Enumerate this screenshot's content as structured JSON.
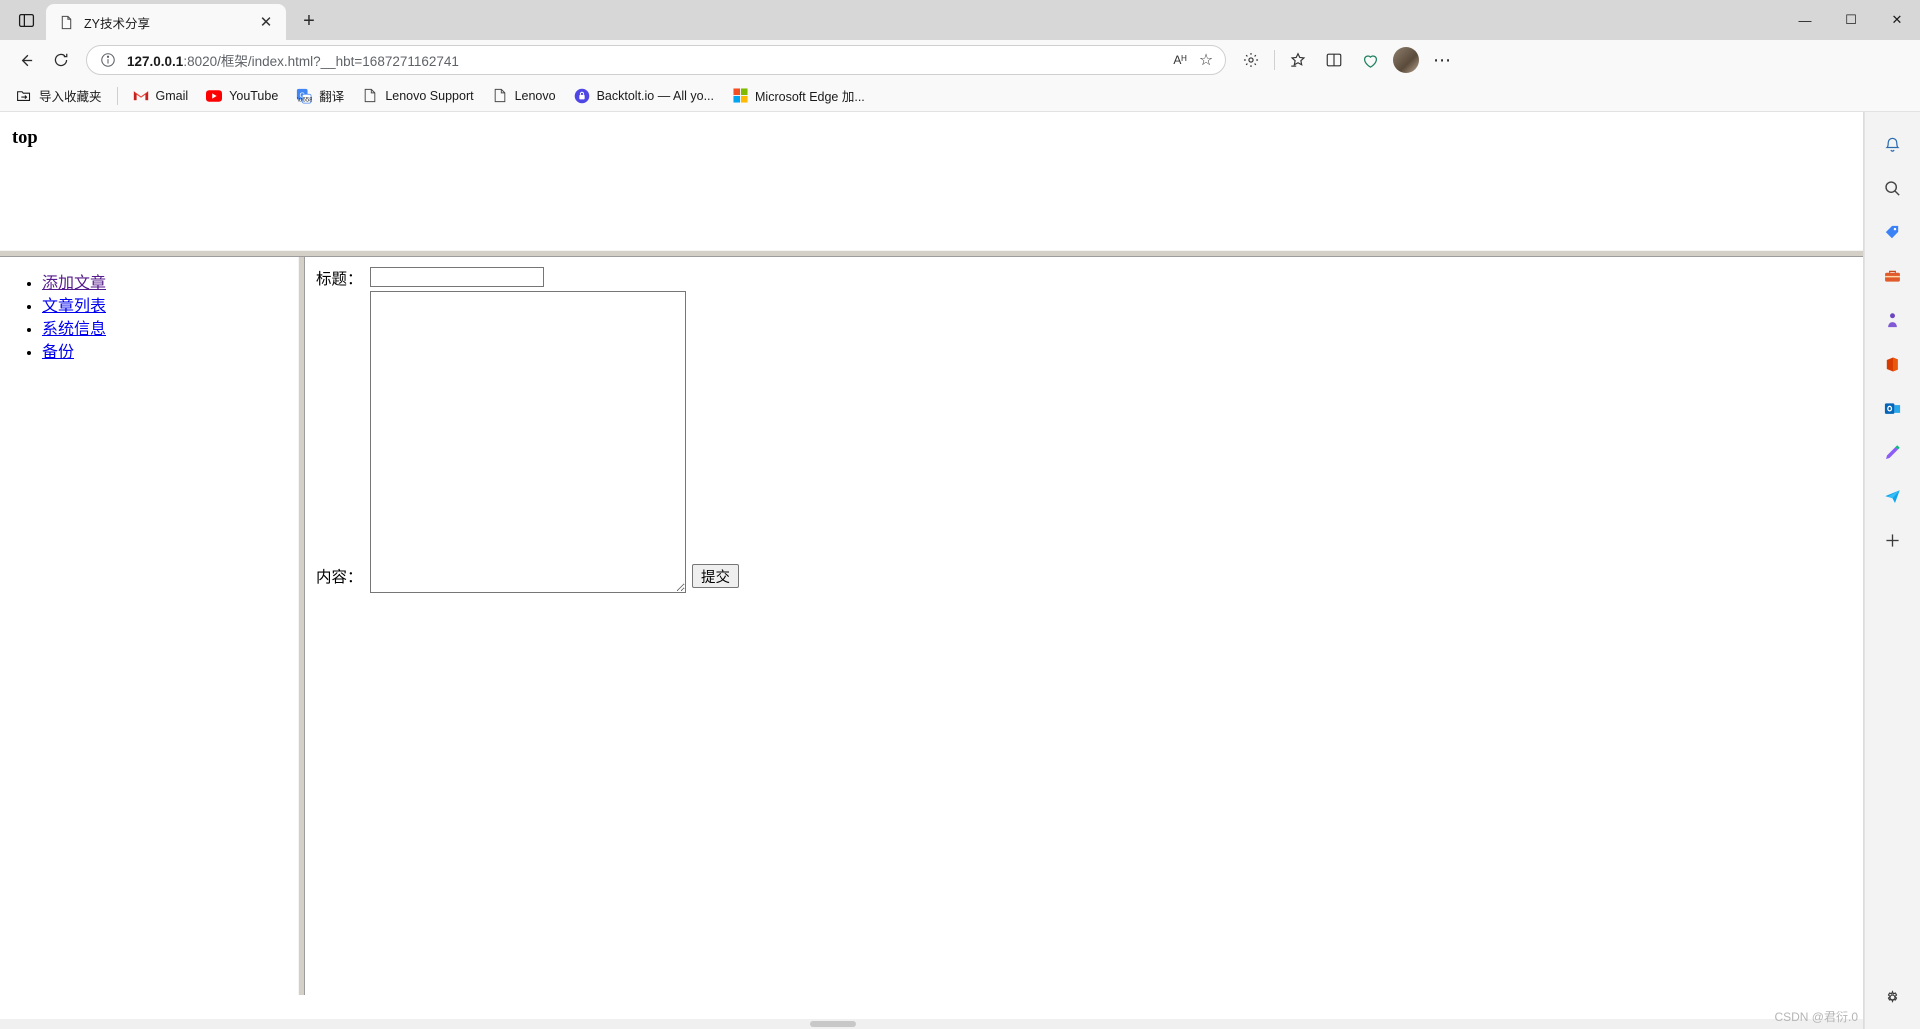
{
  "window": {
    "controls": {
      "minimize": "—",
      "maximize": "☐",
      "close": "✕"
    }
  },
  "tabstrip": {
    "sidebar_toggle": "tab-actions-icon",
    "new_tab_label": "+",
    "tabs": [
      {
        "title": "ZY技术分享",
        "favicon": "document-icon",
        "close": "✕"
      }
    ]
  },
  "navbar": {
    "back": "←",
    "refresh": "⟳",
    "url_host": "127.0.0.1",
    "url_rest": ":8020/框架/index.html?__hbt=1687271162741",
    "full_url": "127.0.0.1:8020/框架/index.html?__hbt=1687271162741",
    "read_aloud": "Aᴴ",
    "favorite_star": "☆",
    "collections": "collections-icon",
    "favorites": "favorites-icon",
    "split_screen": "split-screen-icon",
    "browser_essentials": "browser-essentials-icon",
    "settings_more": "⋯"
  },
  "bookmarks": [
    {
      "label": "导入收藏夹",
      "icon": "import-favorites-icon"
    },
    {
      "label": "Gmail",
      "icon": "gmail-icon"
    },
    {
      "label": "YouTube",
      "icon": "youtube-icon"
    },
    {
      "label": "翻译",
      "icon": "translate-icon"
    },
    {
      "label": "Lenovo Support",
      "icon": "document-icon"
    },
    {
      "label": "Lenovo",
      "icon": "document-icon"
    },
    {
      "label": "Backtolt.io — All yo...",
      "icon": "backtolt-icon"
    },
    {
      "label": "Microsoft Edge 加...",
      "icon": "microsoft-icon"
    }
  ],
  "page": {
    "top_frame": {
      "heading": "top"
    },
    "left_frame": {
      "links": [
        {
          "label": "添加文章",
          "visited": true
        },
        {
          "label": "文章列表",
          "visited": false
        },
        {
          "label": "系统信息",
          "visited": false
        },
        {
          "label": "备份",
          "visited": false
        }
      ]
    },
    "main_frame": {
      "title_label": "标题：",
      "title_value": "",
      "title_placeholder": "",
      "content_label": "内容：",
      "content_value": "",
      "content_placeholder": "",
      "submit_label": "提交"
    }
  },
  "edge_sidebar": [
    {
      "name": "notifications-icon"
    },
    {
      "name": "search-icon"
    },
    {
      "name": "shopping-tag-icon"
    },
    {
      "name": "tools-icon"
    },
    {
      "name": "games-icon"
    },
    {
      "name": "office-icon"
    },
    {
      "name": "outlook-icon"
    },
    {
      "name": "drawing-icon"
    },
    {
      "name": "paper-plane-icon"
    },
    {
      "name": "add-sidebar-icon"
    },
    {
      "name": "sidebar-settings-icon"
    }
  ],
  "watermark": "CSDN @君衍.0",
  "colors": {
    "link": "#0000ee",
    "visited_link": "#551a8b",
    "chrome_bg": "#f9f9f9",
    "tabstrip_bg": "#d7d7d7",
    "frame_splitter": "#d4d0c8"
  }
}
